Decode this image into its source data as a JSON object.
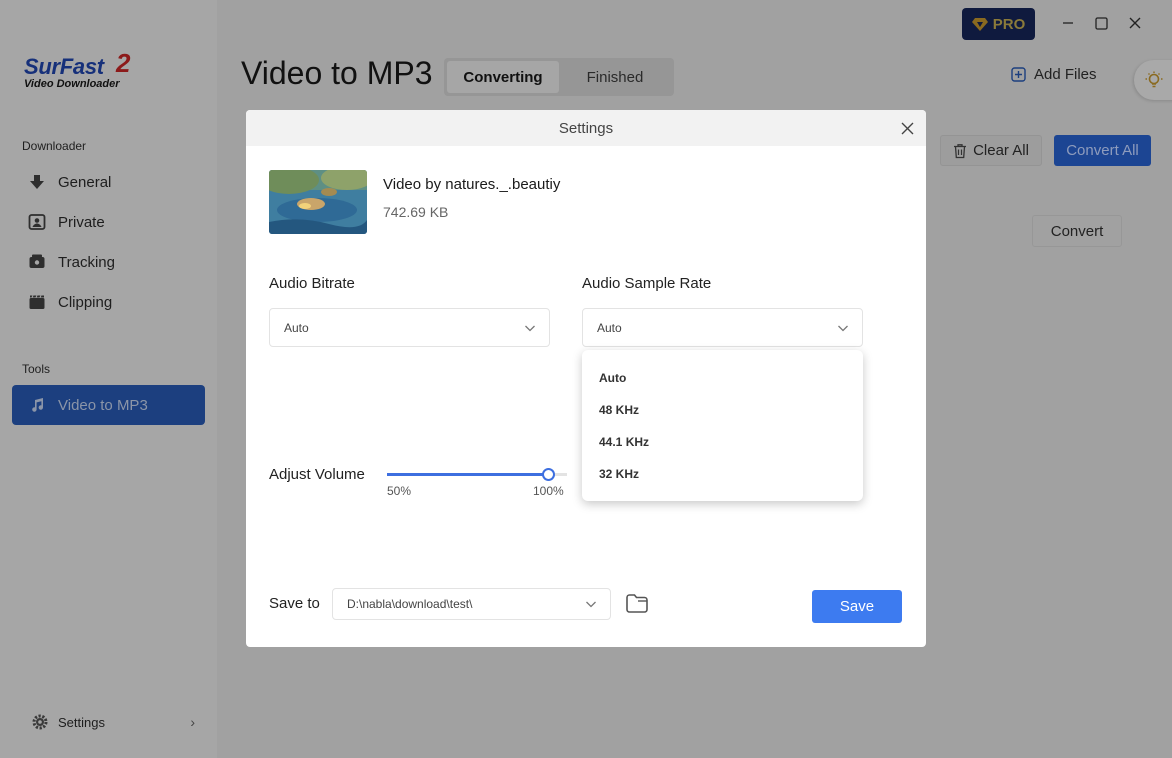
{
  "app": {
    "logo_name": "SurFast",
    "logo_version": "2",
    "logo_sub": "Video Downloader"
  },
  "sidebar": {
    "section_downloader": "Downloader",
    "downloader_items": [
      {
        "label": "General",
        "icon": "download-icon"
      },
      {
        "label": "Private",
        "icon": "private-icon"
      },
      {
        "label": "Tracking",
        "icon": "tracking-icon"
      },
      {
        "label": "Clipping",
        "icon": "clipping-icon"
      }
    ],
    "section_tools": "Tools",
    "tools_items": [
      {
        "label": "Video to MP3",
        "icon": "music-note-icon",
        "active": true
      }
    ],
    "settings_label": "Settings"
  },
  "header": {
    "page_title": "Video to MP3",
    "tabs": [
      {
        "label": "Converting",
        "active": true
      },
      {
        "label": "Finished",
        "active": false
      }
    ],
    "pro_label": "PRO",
    "add_files_label": "Add Files",
    "clear_all_label": "Clear All",
    "convert_all_label": "Convert All",
    "convert_label": "Convert"
  },
  "modal": {
    "title": "Settings",
    "file": {
      "name": "Video by natures._.beautiy",
      "size": "742.69 KB"
    },
    "audio_bitrate": {
      "label": "Audio Bitrate",
      "value": "Auto"
    },
    "audio_sample_rate": {
      "label": "Audio Sample Rate",
      "value": "Auto",
      "options": [
        "Auto",
        "48 KHz",
        "44.1 KHz",
        "32 KHz"
      ]
    },
    "volume": {
      "label": "Adjust Volume",
      "min_label": "50%",
      "max_label": "100%",
      "level_fraction": 1.0
    },
    "save_to": {
      "label": "Save to",
      "path": "D:\\nabla\\download\\test\\"
    },
    "save_label": "Save"
  },
  "colors": {
    "accent": "#3d7bf0",
    "sidebar_active": "#1c3f7f",
    "pro_bg": "#0f1a3e"
  }
}
